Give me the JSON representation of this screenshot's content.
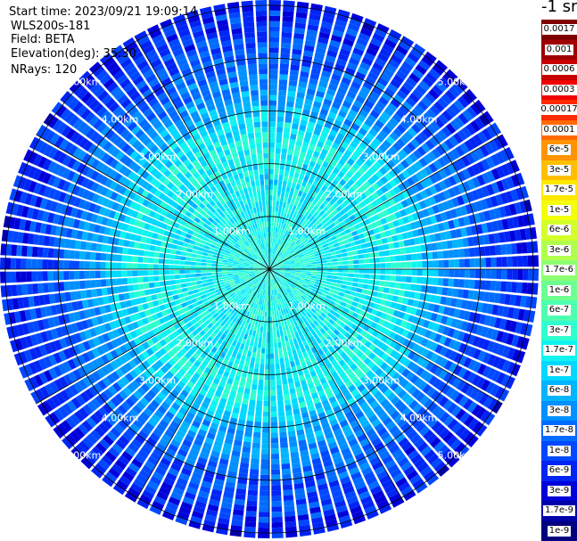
{
  "info": {
    "start_time": "Start time: 2023/09/21 19:09:14",
    "instrument": "WLS200s-181",
    "field": "Field: BETA",
    "elevation": "Elevation(deg): 35.30",
    "nrays": "NRays: 120"
  },
  "colorbar": {
    "unit": "-1 sr",
    "levels": [
      {
        "label": "0.0017",
        "color": "#7f0000"
      },
      {
        "label": "0.001",
        "color": "#a00000"
      },
      {
        "label": "0.0006",
        "color": "#c80000"
      },
      {
        "label": "0.0003",
        "color": "#f00000"
      },
      {
        "label": "0.00017",
        "color": "#ff2a00"
      },
      {
        "label": "0.0001",
        "color": "#ff6a00"
      },
      {
        "label": "6e-5",
        "color": "#ff9400"
      },
      {
        "label": "3e-5",
        "color": "#ffbf00"
      },
      {
        "label": "1.7e-5",
        "color": "#ffe900"
      },
      {
        "label": "1e-5",
        "color": "#f4ff0a"
      },
      {
        "label": "6e-6",
        "color": "#d3ff2b"
      },
      {
        "label": "3e-6",
        "color": "#b0ff4e"
      },
      {
        "label": "1.7e-6",
        "color": "#8cff72"
      },
      {
        "label": "1e-6",
        "color": "#6cff92"
      },
      {
        "label": "6e-7",
        "color": "#4effb0"
      },
      {
        "label": "3e-7",
        "color": "#2effd0"
      },
      {
        "label": "1.7e-7",
        "color": "#10f4f0"
      },
      {
        "label": "1e-7",
        "color": "#00d8ff"
      },
      {
        "label": "6e-8",
        "color": "#00b4ff"
      },
      {
        "label": "3e-8",
        "color": "#0090ff"
      },
      {
        "label": "1.7e-8",
        "color": "#006cff"
      },
      {
        "label": "1e-8",
        "color": "#0048ff"
      },
      {
        "label": "6e-9",
        "color": "#0024f4"
      },
      {
        "label": "3e-9",
        "color": "#0000d8"
      },
      {
        "label": "1.7e-9",
        "color": "#0000a8"
      },
      {
        "label": "1e-9",
        "color": "#00007f"
      }
    ]
  },
  "chart_data": {
    "type": "heatmap",
    "projection": "polar PPI",
    "field": "BETA",
    "nrays": 120,
    "rings_km": [
      1,
      2,
      3,
      4,
      5
    ],
    "ring_labels": [
      "1.00km",
      "2.00km",
      "3.00km",
      "4.00km",
      "5.00km"
    ],
    "range_extent_km": 5.1,
    "spokes": 12,
    "radial_profile_log10": [
      {
        "range_km": 0.0,
        "value": -6.6
      },
      {
        "range_km": 1.0,
        "value": -6.7
      },
      {
        "range_km": 1.8,
        "value": -6.8
      },
      {
        "range_km": 2.5,
        "value": -6.7
      },
      {
        "range_km": 3.2,
        "value": -7.3
      },
      {
        "range_km": 4.0,
        "value": -7.8
      },
      {
        "range_km": 5.0,
        "value": -8.2
      }
    ],
    "colorscale": "jet (log)",
    "color_range": [
      1e-09,
      0.0017
    ]
  }
}
